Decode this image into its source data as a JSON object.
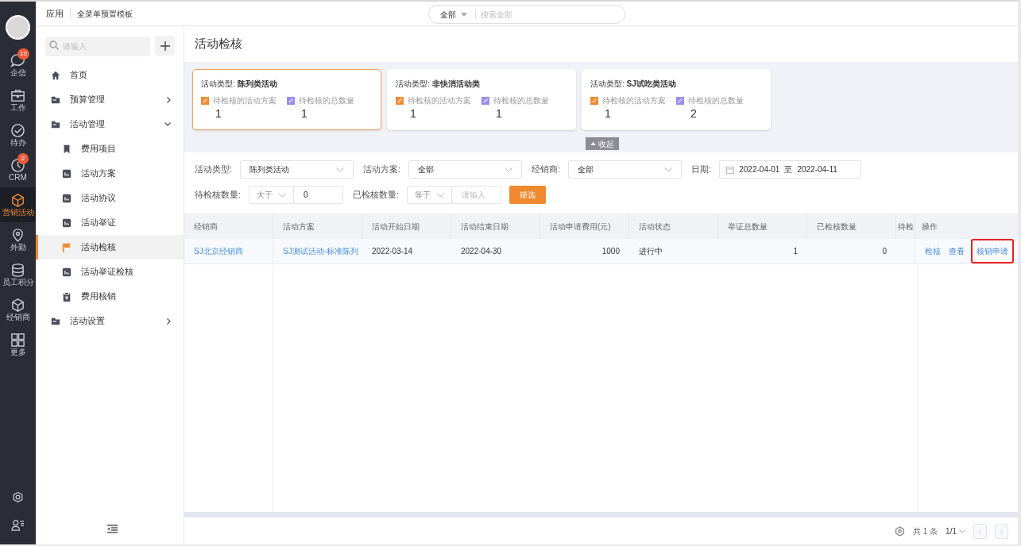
{
  "rail": {
    "items": [
      {
        "label": "企信",
        "kind": "chat",
        "badge": "10",
        "selected": false
      },
      {
        "label": "工作",
        "kind": "briefcase",
        "selected": false
      },
      {
        "label": "待办",
        "kind": "check",
        "selected": false
      },
      {
        "label": "CRM",
        "kind": "clock",
        "badge": "2",
        "selected": false
      },
      {
        "label": "营销活动",
        "kind": "cube",
        "selected": true
      },
      {
        "label": "外勤",
        "kind": "pin",
        "selected": false
      },
      {
        "label": "员工积分",
        "kind": "database",
        "selected": false
      },
      {
        "label": "经销商",
        "kind": "cube",
        "selected": false
      },
      {
        "label": "更多",
        "kind": "grid",
        "selected": false
      }
    ]
  },
  "topbar": {
    "app_label": "应用",
    "template": "全菜单预置模板",
    "search": {
      "scope": "全部",
      "placeholder": "搜索全部"
    }
  },
  "sidebar": {
    "search_placeholder": "请输入",
    "menu": [
      {
        "label": "首页",
        "kind": "home",
        "selected": false
      },
      {
        "label": "预算管理",
        "kind": "folder",
        "expanded": false,
        "selected": false
      },
      {
        "label": "活动管理",
        "kind": "folder",
        "expanded": true,
        "selected": false,
        "children": [
          {
            "label": "费用项目",
            "kind": "bookmark",
            "selected": false
          },
          {
            "label": "活动方案",
            "kind": "doc",
            "selected": false
          },
          {
            "label": "活动协议",
            "kind": "doc",
            "selected": false
          },
          {
            "label": "活动举证",
            "kind": "doc",
            "selected": false
          },
          {
            "label": "活动检核",
            "kind": "flag",
            "selected": true
          },
          {
            "label": "活动举证检核",
            "kind": "doc",
            "selected": false
          },
          {
            "label": "费用核销",
            "kind": "clipboard",
            "selected": false
          }
        ]
      },
      {
        "label": "活动设置",
        "kind": "folder",
        "expanded": false,
        "selected": false
      }
    ]
  },
  "page_title": "活动检核",
  "cards": [
    {
      "type_label": "活动类型:",
      "type_name": "陈列类活动",
      "selected": true,
      "stats": [
        {
          "label": "待检核的活动方案",
          "value": "1",
          "color": "#f08a31"
        },
        {
          "label": "待检核的总数量",
          "value": "1",
          "color": "#9b8ce8"
        }
      ]
    },
    {
      "type_label": "活动类型:",
      "type_name": "非快消活动类",
      "selected": false,
      "stats": [
        {
          "label": "待检核的活动方案",
          "value": "1",
          "color": "#f08a31"
        },
        {
          "label": "待检核的总数量",
          "value": "1",
          "color": "#9b8ce8"
        }
      ]
    },
    {
      "type_label": "活动类型:",
      "type_name": "SJ试吃类活动",
      "selected": false,
      "stats": [
        {
          "label": "待检核的活动方案",
          "value": "1",
          "color": "#f08a31"
        },
        {
          "label": "待检核的总数量",
          "value": "2",
          "color": "#9b8ce8"
        }
      ]
    }
  ],
  "collapse_button": "收起",
  "filter_rows": [
    [
      {
        "kind": "select",
        "label": "活动类型:",
        "value": "陈列类活动"
      },
      {
        "kind": "select",
        "label": "活动方案:",
        "value": "全部"
      },
      {
        "kind": "select",
        "label": "经销商:",
        "value": "全部"
      },
      {
        "kind": "daterange",
        "label": "日期:",
        "start": "2022-04-01",
        "separator": "至",
        "end": "2022-04-11"
      }
    ],
    [
      {
        "kind": "compare",
        "label": "待检核数量:",
        "operator": "大于",
        "value": "0"
      },
      {
        "kind": "compare",
        "label": "已检核数量:",
        "operator": "等于",
        "placeholder": "请输入"
      },
      {
        "kind": "button",
        "label": "筛选"
      }
    ]
  ],
  "table": {
    "columns": [
      {
        "label": "经销商"
      },
      {
        "label": "活动方案"
      },
      {
        "label": "活动开始日期"
      },
      {
        "label": "活动结束日期"
      },
      {
        "label": "活动申请费用(元)"
      },
      {
        "label": "活动状态"
      },
      {
        "label": "举证总数量"
      },
      {
        "label": "已检核数量"
      },
      {
        "label": "待检"
      }
    ],
    "actions_column": "操作",
    "rows": [
      {
        "cells": [
          {
            "text": "SJ北京经销商",
            "kind": "link"
          },
          {
            "text": "SJ测试活动-标准陈列",
            "kind": "link"
          },
          {
            "text": "2022-03-14",
            "kind": "text"
          },
          {
            "text": "2022-04-30",
            "kind": "text"
          },
          {
            "text": "1000",
            "kind": "number"
          },
          {
            "text": "进行中",
            "kind": "text"
          },
          {
            "text": "1",
            "kind": "number"
          },
          {
            "text": "0",
            "kind": "number"
          }
        ],
        "actions": [
          {
            "label": "检核",
            "highlighted": false
          },
          {
            "label": "查看",
            "highlighted": false
          },
          {
            "label": "核销申请",
            "highlighted": true
          }
        ]
      }
    ]
  },
  "pagination": {
    "total": "共 1 条",
    "page": "1/1",
    "prev_disabled": true,
    "next_disabled": true
  }
}
